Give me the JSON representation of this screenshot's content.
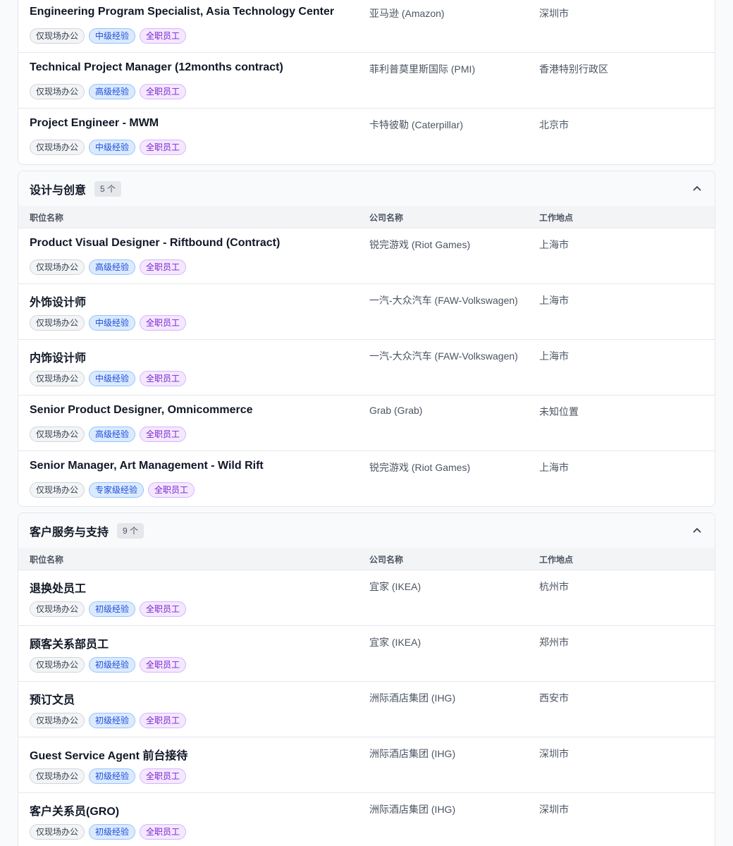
{
  "columns": {
    "title": "职位名称",
    "company": "公司名称",
    "location": "工作地点"
  },
  "sections": [
    {
      "title": "",
      "count": "",
      "jobs": [
        {
          "title": "Engineering Program Specialist, Asia Technology Center",
          "company": "亚马逊 (Amazon)",
          "location": "深圳市",
          "tags": [
            "仅现场办公",
            "中级经验",
            "全职员工"
          ]
        },
        {
          "title": "Technical Project Manager (12months contract)",
          "company": "菲利普莫里斯国际 (PMI)",
          "location": "香港特别行政区",
          "tags": [
            "仅现场办公",
            "高级经验",
            "全职员工"
          ]
        },
        {
          "title": "Project Engineer - MWM",
          "company": "卡特彼勒 (Caterpillar)",
          "location": "北京市",
          "tags": [
            "仅现场办公",
            "中级经验",
            "全职员工"
          ]
        }
      ]
    },
    {
      "title": "设计与创意",
      "count": "5 个",
      "jobs": [
        {
          "title": "Product Visual Designer - Riftbound (Contract)",
          "company": "锐完游戏 (Riot Games)",
          "location": "上海市",
          "tags": [
            "仅现场办公",
            "高级经验",
            "全职员工"
          ]
        },
        {
          "title": "外饰设计师",
          "company": "一汽-大众汽车 (FAW-Volkswagen)",
          "location": "上海市",
          "tags": [
            "仅现场办公",
            "中级经验",
            "全职员工"
          ]
        },
        {
          "title": "内饰设计师",
          "company": "一汽-大众汽车 (FAW-Volkswagen)",
          "location": "上海市",
          "tags": [
            "仅现场办公",
            "中级经验",
            "全职员工"
          ]
        },
        {
          "title": "Senior Product Designer, Omnicommerce",
          "company": "Grab (Grab)",
          "location": "未知位置",
          "tags": [
            "仅现场办公",
            "高级经验",
            "全职员工"
          ]
        },
        {
          "title": "Senior Manager, Art Management - Wild Rift",
          "company": "锐完游戏 (Riot Games)",
          "location": "上海市",
          "tags": [
            "仅现场办公",
            "专家级经验",
            "全职员工"
          ]
        }
      ]
    },
    {
      "title": "客户服务与支持",
      "count": "9 个",
      "jobs": [
        {
          "title": "退换处员工",
          "company": "宜家 (IKEA)",
          "location": "杭州市",
          "tags": [
            "仅现场办公",
            "初级经验",
            "全职员工"
          ]
        },
        {
          "title": "顾客关系部员工",
          "company": "宜家 (IKEA)",
          "location": "郑州市",
          "tags": [
            "仅现场办公",
            "初级经验",
            "全职员工"
          ]
        },
        {
          "title": "预订文员",
          "company": "洲际酒店集团 (IHG)",
          "location": "西安市",
          "tags": [
            "仅现场办公",
            "初级经验",
            "全职员工"
          ]
        },
        {
          "title": "Guest Service Agent 前台接待",
          "company": "洲际酒店集团 (IHG)",
          "location": "深圳市",
          "tags": [
            "仅现场办公",
            "初级经验",
            "全职员工"
          ]
        },
        {
          "title": "客户关系员(GRO)",
          "company": "洲际酒店集团 (IHG)",
          "location": "深圳市",
          "tags": [
            "仅现场办公",
            "初级经验",
            "全职员工"
          ]
        }
      ]
    }
  ],
  "icons": {
    "collapse": "chevron-up-icon"
  },
  "colors": {
    "tag_work_mode": "#f3f4f6",
    "tag_level": "#dbeafe",
    "tag_type": "#f3e8ff"
  }
}
